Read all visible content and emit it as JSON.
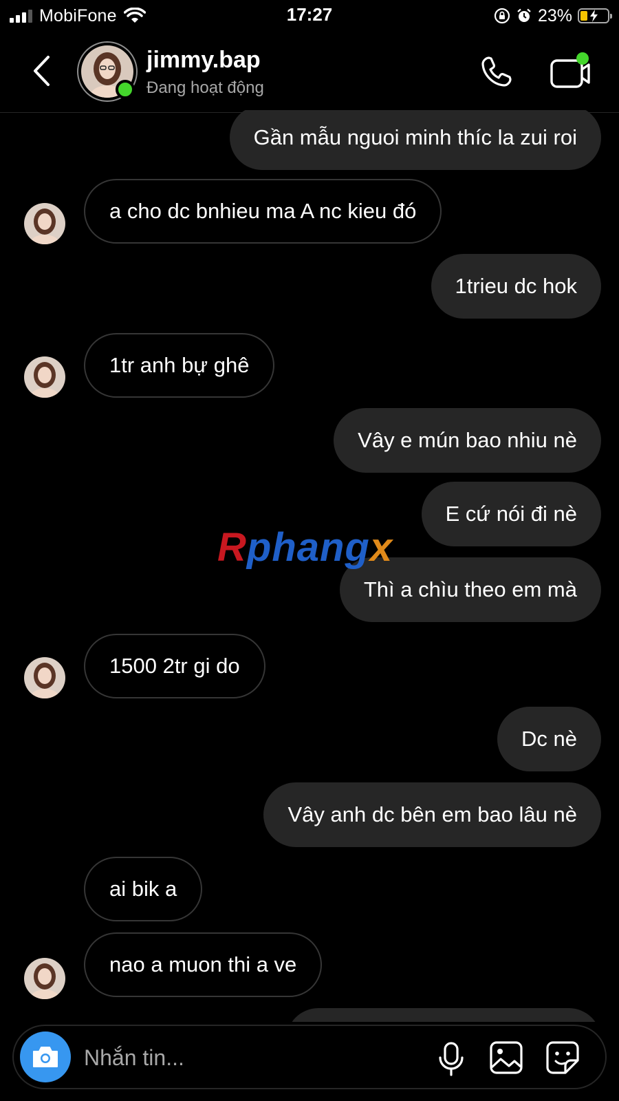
{
  "status_bar": {
    "carrier": "MobiFone",
    "time": "17:27",
    "battery_percent": "23%",
    "battery_level": 0.23,
    "icons": [
      "signal-icon",
      "wifi-icon",
      "orientation-lock-icon",
      "alarm-icon",
      "battery-charging-icon"
    ]
  },
  "header": {
    "username": "jimmy.bap",
    "activity_status": "Đang hoạt động",
    "online": true,
    "icons": [
      "back-icon",
      "phone-icon",
      "video-call-icon"
    ]
  },
  "messages": [
    {
      "sender": "me",
      "text": "Gần mẫu nguoi minh thíc la zui roi"
    },
    {
      "sender": "them",
      "text": "a cho dc bnhieu ma A nc kieu đó"
    },
    {
      "sender": "me",
      "text": "1trieu dc hok"
    },
    {
      "sender": "them",
      "text": "1tr anh bự ghê"
    },
    {
      "sender": "me",
      "text": "Vây e mún bao nhiu nè"
    },
    {
      "sender": "me",
      "text": "E cứ nói đi nè"
    },
    {
      "sender": "me",
      "text": "Thì a chìu theo em mà"
    },
    {
      "sender": "them",
      "text": "1500 2tr gi do"
    },
    {
      "sender": "me",
      "text": "Dc nè"
    },
    {
      "sender": "me",
      "text": "Vây anh dc bên em bao lâu nè"
    },
    {
      "sender": "them",
      "text": "ai bik a"
    },
    {
      "sender": "them",
      "text": "nao a muon thi a ve"
    }
  ],
  "watermark": {
    "part1": "R",
    "part2": "phang",
    "part3": "x"
  },
  "composer": {
    "placeholder": "Nhắn tin...",
    "value": "",
    "icons": [
      "camera-icon",
      "microphone-icon",
      "gallery-icon",
      "sticker-icon"
    ]
  },
  "colors": {
    "background": "#000000",
    "outgoing_bubble": "#262626",
    "incoming_border": "#363636",
    "online_green": "#44d62c",
    "camera_blue": "#3797f0",
    "secondary_text": "#a8a8a8"
  }
}
